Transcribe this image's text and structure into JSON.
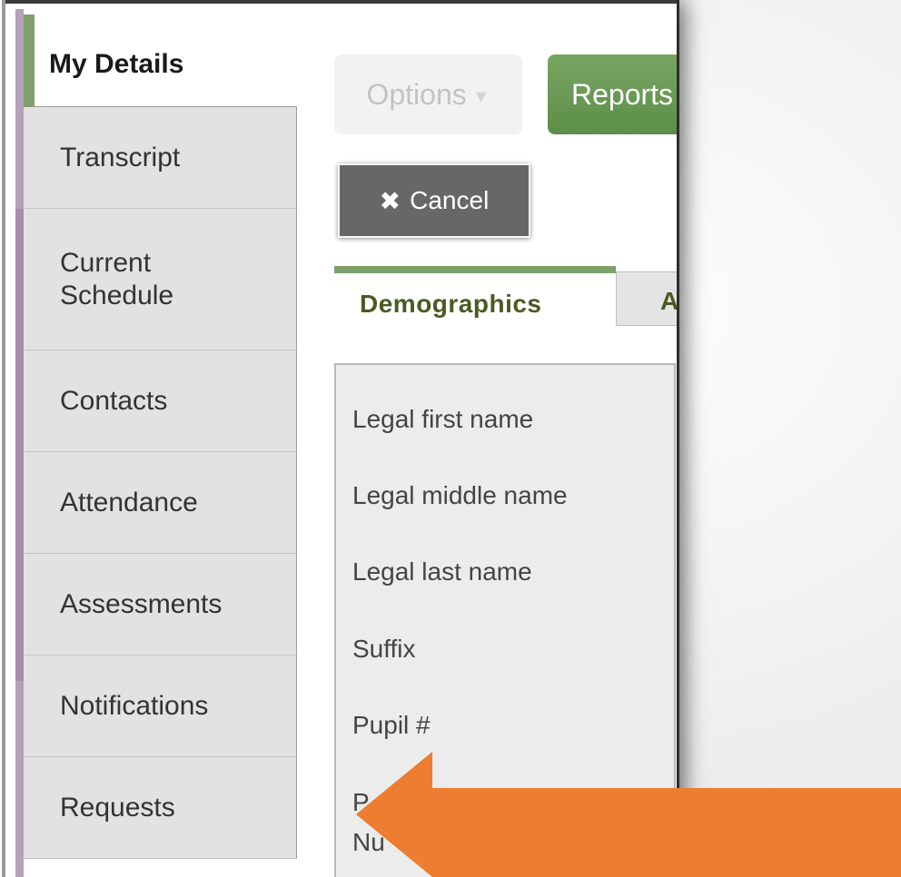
{
  "sidebar": {
    "items": [
      {
        "label": "My Details"
      },
      {
        "label": "Transcript"
      },
      {
        "label": "Current\nSchedule"
      },
      {
        "label": "Contacts"
      },
      {
        "label": "Attendance"
      },
      {
        "label": "Assessments"
      },
      {
        "label": "Notifications"
      },
      {
        "label": "Requests"
      }
    ]
  },
  "toolbar": {
    "options_label": "Options",
    "reports_label": "Reports",
    "cancel_label": "Cancel"
  },
  "tabs": [
    {
      "label": "Demographics"
    },
    {
      "label": "A"
    }
  ],
  "form": {
    "fields": [
      {
        "label": "Legal first name"
      },
      {
        "label": "Legal middle name"
      },
      {
        "label": "Legal last name"
      },
      {
        "label": "Suffix"
      },
      {
        "label": "Pupil #"
      },
      {
        "label": "P"
      },
      {
        "label": "Nu"
      }
    ]
  },
  "colors": {
    "accent_green": "#7ea06a",
    "reports_green": "#5c8e48",
    "cancel_gray": "#676767",
    "arrow_orange": "#ed7d31"
  }
}
